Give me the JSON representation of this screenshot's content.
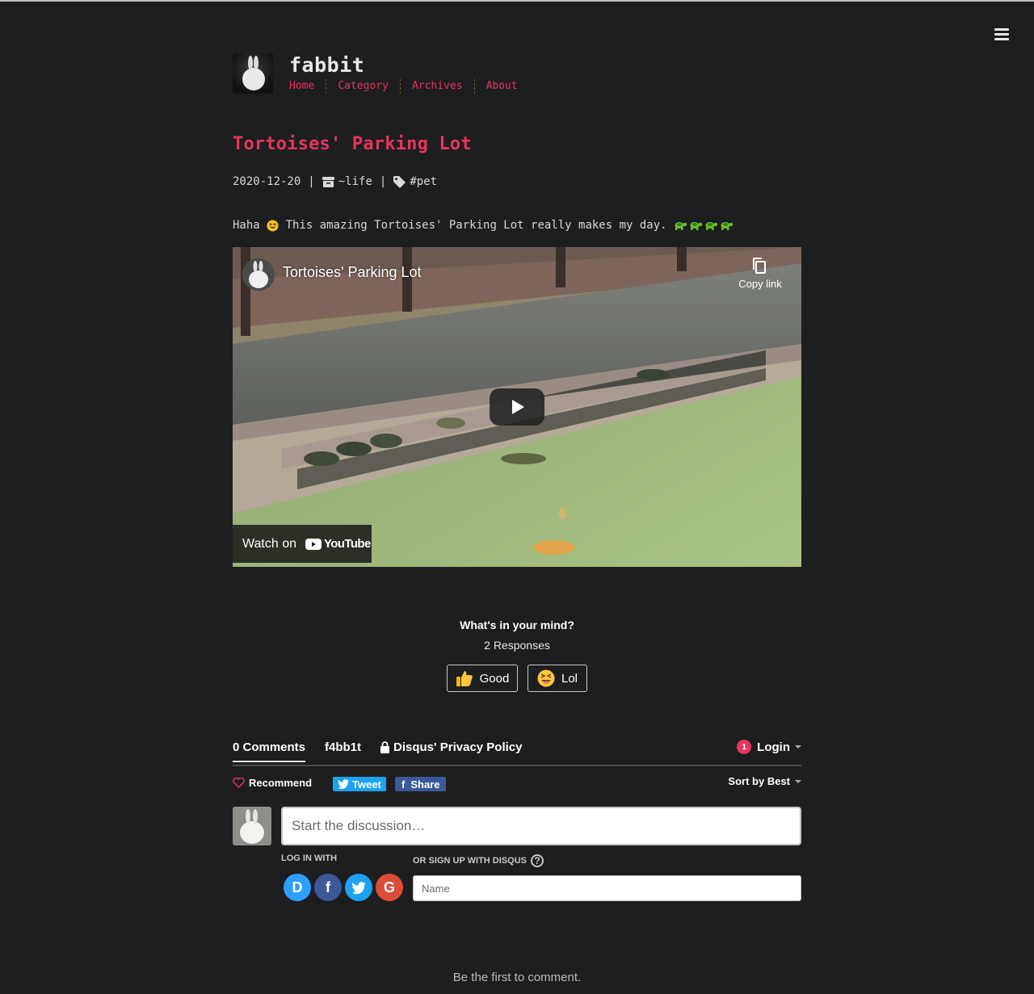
{
  "site": {
    "title": "fabbit"
  },
  "nav": [
    {
      "label": "Home"
    },
    {
      "label": "Category"
    },
    {
      "label": "Archives"
    },
    {
      "label": "About"
    }
  ],
  "post": {
    "title": "Tortoises' Parking Lot",
    "date": "2020-12-20",
    "category": "~life",
    "tag": "#pet",
    "intro_before": "Haha ",
    "intro_after": " This amazing Tortoises' Parking Lot really makes my day. "
  },
  "video": {
    "title": "Tortoises' Parking Lot",
    "copy_link": "Copy link",
    "watch_on": "Watch on",
    "youtube": "YouTube"
  },
  "reactions": {
    "question": "What's in your mind?",
    "responses": "2 Responses",
    "buttons": [
      {
        "label": "Good",
        "icon": "thumbs-up-emoji"
      },
      {
        "label": "Lol",
        "icon": "laughing-emoji"
      }
    ]
  },
  "disqus": {
    "tabs": [
      "0 Comments",
      "f4bb1t",
      "Disqus' Privacy Policy"
    ],
    "login": "Login",
    "notification_count": "1",
    "recommend": "Recommend",
    "tweet": "Tweet",
    "share": "Share",
    "sort": "Sort by Best",
    "placeholder": "Start the discussion…",
    "log_in_with": "LOG IN WITH",
    "or_sign_up": "OR SIGN UP WITH DISQUS",
    "help": "?",
    "name_placeholder": "Name",
    "social": [
      "D",
      "f",
      "t",
      "G"
    ],
    "social_colors": [
      "#2e9fff",
      "#3b5998",
      "#1da1f2",
      "#dd4b39"
    ],
    "empty": "Be the first to comment."
  },
  "colors": {
    "accent": "#e8335e",
    "background": "#1d1e20"
  }
}
